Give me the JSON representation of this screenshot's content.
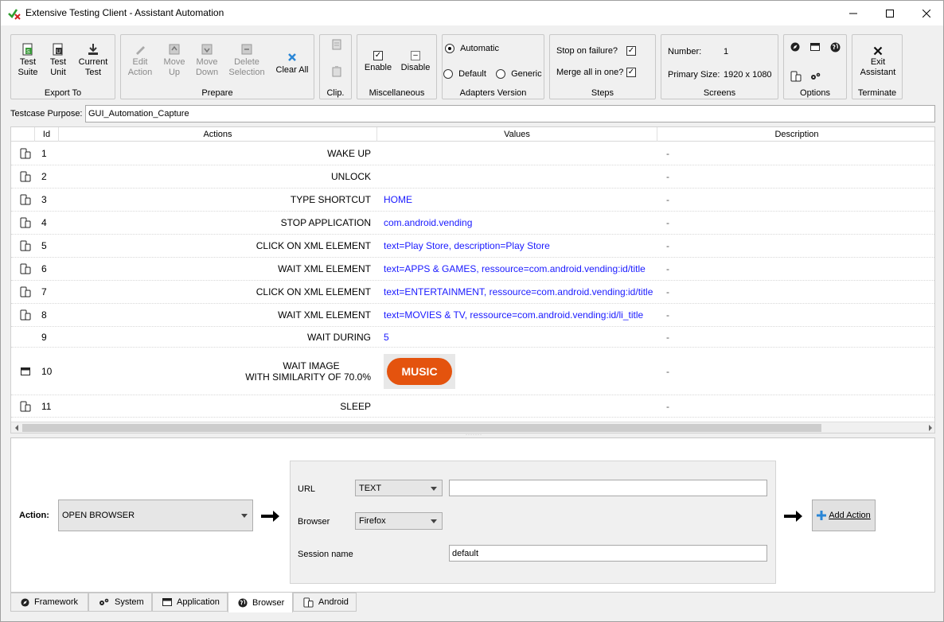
{
  "window": {
    "title": "Extensive Testing Client - Assistant Automation"
  },
  "ribbon": {
    "export_to": {
      "label": "Export To",
      "test_suite": "Test\nSuite",
      "test_unit": "Test\nUnit",
      "current_test": "Current\nTest"
    },
    "prepare": {
      "label": "Prepare",
      "edit_action": "Edit\nAction",
      "move_up": "Move\nUp",
      "move_down": "Move\nDown",
      "delete_selection": "Delete\nSelection",
      "clear_all": "Clear All"
    },
    "clip": {
      "label": "Clip."
    },
    "misc": {
      "label": "Miscellaneous",
      "enable": "Enable",
      "disable": "Disable"
    },
    "adapters": {
      "label": "Adapters Version",
      "automatic": "Automatic",
      "default": "Default",
      "generic": "Generic",
      "selected": "Automatic"
    },
    "steps": {
      "label": "Steps",
      "stop_on_failure": "Stop on failure?",
      "merge_all": "Merge all in one?",
      "stop_checked": true,
      "merge_checked": true
    },
    "screens": {
      "label": "Screens",
      "number_label": "Number:",
      "number_value": "1",
      "primary_label": "Primary Size:",
      "primary_value": "1920 x 1080"
    },
    "options": {
      "label": "Options"
    },
    "terminate": {
      "label": "Terminate",
      "exit": "Exit\nAssistant"
    }
  },
  "purpose": {
    "label": "Testcase Purpose:",
    "value": "GUI_Automation_Capture"
  },
  "table": {
    "headers": {
      "id": "Id",
      "actions": "Actions",
      "values": "Values",
      "description": "Description"
    },
    "rows": [
      {
        "icon": "android-icon",
        "id": "1",
        "action": "WAKE UP",
        "value": "",
        "desc": "-"
      },
      {
        "icon": "android-icon",
        "id": "2",
        "action": "UNLOCK",
        "value": "",
        "desc": "-"
      },
      {
        "icon": "android-icon",
        "id": "3",
        "action": "TYPE SHORTCUT",
        "value": "HOME",
        "desc": "-"
      },
      {
        "icon": "android-icon",
        "id": "4",
        "action": "STOP APPLICATION",
        "value": "com.android.vending",
        "desc": "-"
      },
      {
        "icon": "android-icon",
        "id": "5",
        "action": "CLICK ON XML ELEMENT",
        "value": "text=Play Store, description=Play Store",
        "desc": "-"
      },
      {
        "icon": "android-icon",
        "id": "6",
        "action": "WAIT XML ELEMENT",
        "value": "text=APPS & GAMES, ressource=com.android.vending:id/title",
        "desc": "-"
      },
      {
        "icon": "android-icon",
        "id": "7",
        "action": "CLICK ON XML ELEMENT",
        "value": "text=ENTERTAINMENT, ressource=com.android.vending:id/title",
        "desc": "-"
      },
      {
        "icon": "android-icon",
        "id": "8",
        "action": "WAIT XML ELEMENT",
        "value": "text=MOVIES & TV, ressource=com.android.vending:id/li_title",
        "desc": "-"
      },
      {
        "icon": "",
        "id": "9",
        "action": "WAIT DURING",
        "value": "5",
        "desc": "-"
      },
      {
        "icon": "window-icon",
        "id": "10",
        "action_line1": "WAIT IMAGE",
        "action_line2": "WITH SIMILARITY OF 70.0%",
        "image_text": "MUSIC",
        "desc": "-"
      },
      {
        "icon": "android-icon",
        "id": "11",
        "action": "SLEEP",
        "value": "",
        "desc": "-"
      }
    ]
  },
  "editor": {
    "action_label": "Action:",
    "action_value": "OPEN BROWSER",
    "url_label": "URL",
    "url_type": "TEXT",
    "url_value": "",
    "browser_label": "Browser",
    "browser_value": "Firefox",
    "session_label": "Session name",
    "session_value": "default",
    "add_action": "Add Action"
  },
  "tabs": [
    {
      "label": "Framework",
      "icon": "compass-icon"
    },
    {
      "label": "System",
      "icon": "gears-icon"
    },
    {
      "label": "Application",
      "icon": "window-icon"
    },
    {
      "label": "Browser",
      "icon": "globe-icon",
      "active": true
    },
    {
      "label": "Android",
      "icon": "android-icon"
    }
  ],
  "colors": {
    "value_text": "#1a1aff",
    "music_button": "#e4530e",
    "accent": "#0078d7"
  }
}
